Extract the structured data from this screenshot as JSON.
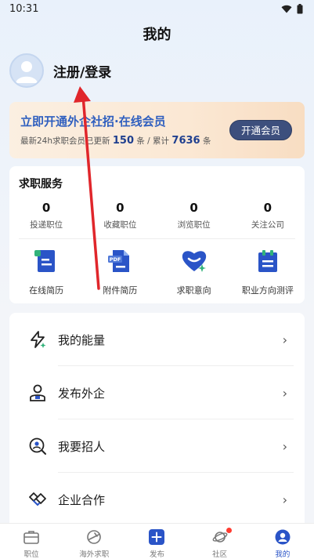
{
  "status_bar": {
    "time": "10:31",
    "wifi_icon": "wifi-icon",
    "battery_icon": "battery-icon"
  },
  "header": {
    "title": "我的"
  },
  "profile": {
    "login_label": "注册/登录",
    "avatar_icon": "user-avatar-icon"
  },
  "member_banner": {
    "title": "立即开通外企社招·在线会员",
    "stats_prefix": "最新24h求职会员已更新",
    "updated_count": "150",
    "unit1": "条 / 累计",
    "total_count": "7636",
    "unit2": "条",
    "button_label": "开通会员",
    "accent": "#2f5fbf"
  },
  "job_services": {
    "title": "求职服务",
    "stats": [
      {
        "value": "0",
        "label": "投递职位"
      },
      {
        "value": "0",
        "label": "收藏职位"
      },
      {
        "value": "0",
        "label": "浏览职位"
      },
      {
        "value": "0",
        "label": "关注公司"
      }
    ],
    "tools": [
      {
        "label": "在线简历",
        "icon": "online-resume-icon"
      },
      {
        "label": "附件简历",
        "icon": "pdf-resume-icon"
      },
      {
        "label": "求职意向",
        "icon": "job-intention-heart-icon"
      },
      {
        "label": "职业方向测评",
        "icon": "career-assessment-icon"
      }
    ]
  },
  "menu": [
    {
      "label": "我的能量",
      "icon": "lightning-icon"
    },
    {
      "label": "发布外企",
      "icon": "publish-company-icon"
    },
    {
      "label": "我要招人",
      "icon": "recruit-search-icon"
    },
    {
      "label": "企业合作",
      "icon": "handshake-icon"
    }
  ],
  "tab_bar": [
    {
      "label": "职位",
      "icon": "briefcase-icon",
      "active": false
    },
    {
      "label": "海外求职",
      "icon": "overseas-plane-icon",
      "active": false
    },
    {
      "label": "发布",
      "icon": "plus-icon",
      "active": false
    },
    {
      "label": "社区",
      "icon": "community-planet-icon",
      "active": false,
      "badge": true
    },
    {
      "label": "我的",
      "icon": "profile-icon",
      "active": true
    }
  ],
  "colors": {
    "brand_blue": "#2a54c7",
    "annotation_red": "#e0262b"
  }
}
